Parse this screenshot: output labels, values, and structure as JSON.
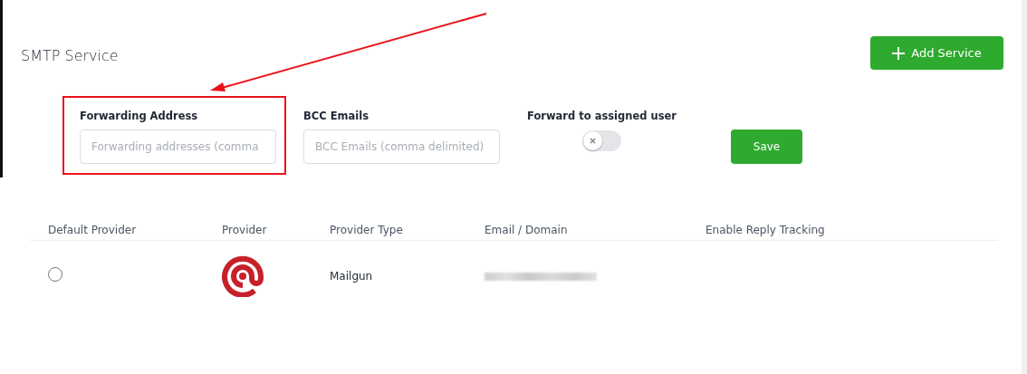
{
  "title": "SMTP Service",
  "add_button": {
    "label": "Add Service"
  },
  "form": {
    "fields": [
      {
        "label": "Forwarding Address",
        "placeholder": "Forwarding addresses (comma"
      },
      {
        "label": "BCC Emails",
        "placeholder": "BCC Emails (comma delimited)"
      }
    ],
    "toggle": {
      "label": "Forward to assigned user",
      "on": false
    },
    "save_button": {
      "label": "Save"
    }
  },
  "table": {
    "columns": [
      "Default Provider",
      "Provider",
      "Provider Type",
      "Email / Domain",
      "Enable Reply Tracking"
    ],
    "rows": [
      {
        "selected": false,
        "provider_type": "Mailgun"
      }
    ]
  }
}
